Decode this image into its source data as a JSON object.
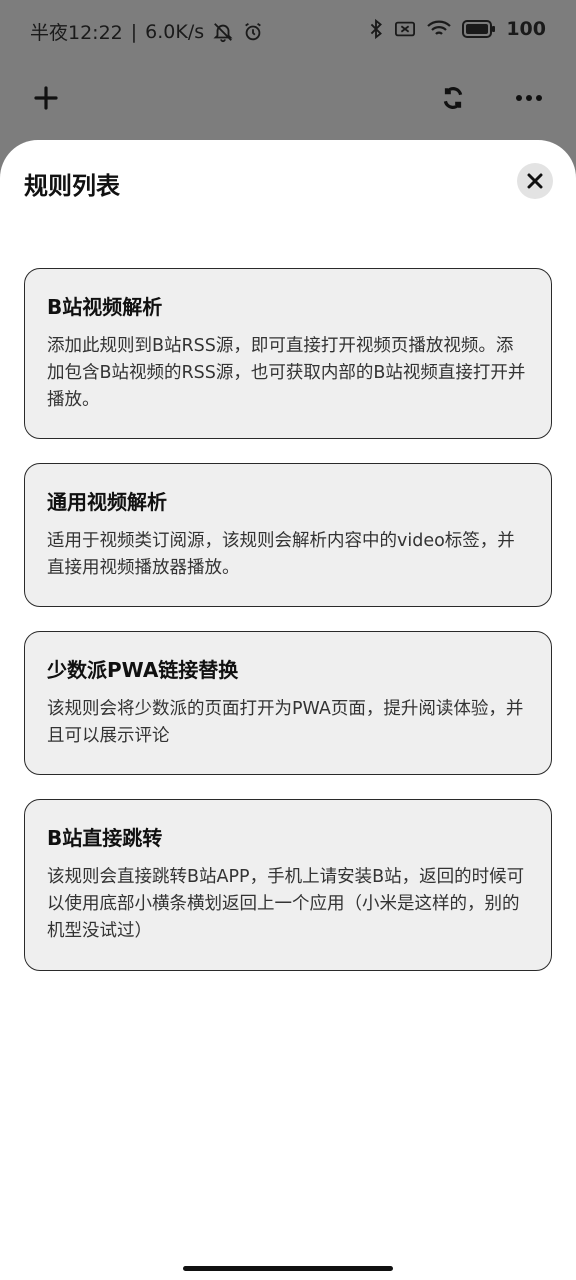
{
  "status_bar": {
    "time": "半夜12:22",
    "separator": "|",
    "speed": "6.0K/s",
    "battery_percent": "100"
  },
  "top_bar": {
    "add_icon": "plus-icon",
    "refresh_icon": "refresh-icon",
    "more_icon": "more-icon"
  },
  "sheet": {
    "title": "规则列表",
    "close_icon": "close-icon"
  },
  "rules": [
    {
      "title": "B站视频解析",
      "description": "添加此规则到B站RSS源，即可直接打开视频页播放视频。添加包含B站视频的RSS源，也可获取内部的B站视频直接打开并播放。"
    },
    {
      "title": "通用视频解析",
      "description": "适用于视频类订阅源，该规则会解析内容中的video标签，并直接用视频播放器播放。"
    },
    {
      "title": "少数派PWA链接替换",
      "description": "该规则会将少数派的页面打开为PWA页面，提升阅读体验，并且可以展示评论"
    },
    {
      "title": "B站直接跳转",
      "description": "该规则会直接跳转B站APP，手机上请安装B站，返回的时候可以使用底部小横条横划返回上一个应用（小米是这样的，别的机型没试过）"
    }
  ]
}
